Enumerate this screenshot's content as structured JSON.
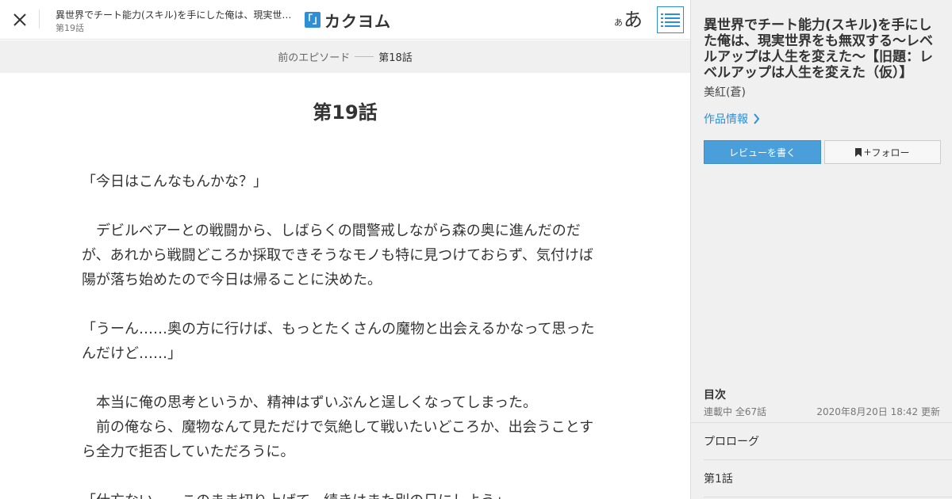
{
  "header": {
    "work_title_short": "異世界でチート能力(スキル)を手にした俺は、現実世界をも無双する～レベルアップは人生を変えた～",
    "episode_label": "第19話",
    "logo_mark": "「」",
    "logo_text": "カクヨム",
    "font_size_small": "あ",
    "font_size_large": "あ"
  },
  "nav": {
    "prev_label": "前のエピソード",
    "prev_episode": "第18話"
  },
  "episode": {
    "title": "第19話",
    "paragraphs": [
      "「今日はこんなもんかな？」",
      "",
      "　デビルベアーとの戦闘から、しばらくの間警戒しながら森の奥に進んだのだが、あれから戦闘どころか採取できそうなモノも特に見つけておらず、気付けば陽が落ち始めたので今日は帰ることに決めた。",
      "",
      "「うーん……奥の方に行けば、もっとたくさんの魔物と出会えるかなって思ったんだけど……」",
      "",
      "　本当に俺の思考というか、精神はずいぶんと逞しくなってしまった。",
      "　前の俺なら、魔物なんて見ただけで気絶して戦いたいどころか、出会うことすら全力で拒否していただろうに。",
      "",
      "「仕方ない……このまま切り上げて、続きはまた別の日にしよう」"
    ]
  },
  "sidebar": {
    "work_title": "異世界でチート能力(スキル)を手にした俺は、現実世界をも無双する～レベルアップは人生を変えた～【旧題：レベルアップは人生を変えた（仮）】",
    "author": "美紅(蒼)",
    "info_link": "作品情報",
    "review_button": "レビューを書く",
    "follow_button": "フォロー",
    "follow_plus": "+",
    "toc_heading": "目次",
    "toc_status": "連載中 全67話",
    "toc_updated": "2020年8月20日 18:42 更新",
    "toc_items": [
      "プロローグ",
      "第1話"
    ]
  },
  "colors": {
    "accent": "#2e8fd6",
    "review_button_bg": "#4a9fdb",
    "sidebar_bg": "#f0f0f0",
    "nav_bg": "#f0f0f0"
  },
  "icons": {
    "close": "close-icon",
    "toc": "list-icon",
    "info": "chevron-right-icon",
    "follow": "bookmark-icon"
  }
}
